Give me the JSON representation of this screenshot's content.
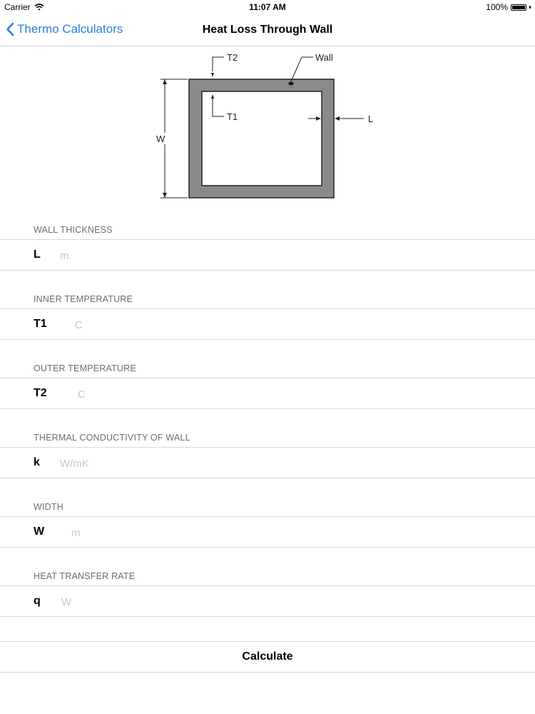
{
  "status_bar": {
    "carrier": "Carrier",
    "time": "11:07 AM",
    "battery": "100%",
    "wifi_icon": "wifi-icon",
    "battery_icon": "battery-icon"
  },
  "nav": {
    "back_label": "Thermo Calculators",
    "back_icon": "chevron-left-icon",
    "title": "Heat Loss Through Wall",
    "accent_color": "#2a7fe0"
  },
  "diagram": {
    "labels": {
      "t2": "T2",
      "wall": "Wall",
      "t1": "T1",
      "l": "L",
      "w": "W"
    }
  },
  "fields": [
    {
      "header": "WALL THICKNESS",
      "symbol": "L",
      "placeholder": "m",
      "value": ""
    },
    {
      "header": "INNER TEMPERATURE",
      "symbol": "T1",
      "placeholder": "C",
      "value": ""
    },
    {
      "header": "OUTER TEMPERATURE",
      "symbol": "T2",
      "placeholder": "C",
      "value": ""
    },
    {
      "header": "THERMAL CONDUCTIVITY OF WALL",
      "symbol": "k",
      "placeholder": "W/mK",
      "value": ""
    },
    {
      "header": "WIDTH",
      "symbol": "W",
      "placeholder": "m",
      "value": ""
    },
    {
      "header": "HEAT TRANSFER RATE",
      "symbol": "q",
      "placeholder": "W",
      "value": ""
    }
  ],
  "calculate_label": "Calculate"
}
